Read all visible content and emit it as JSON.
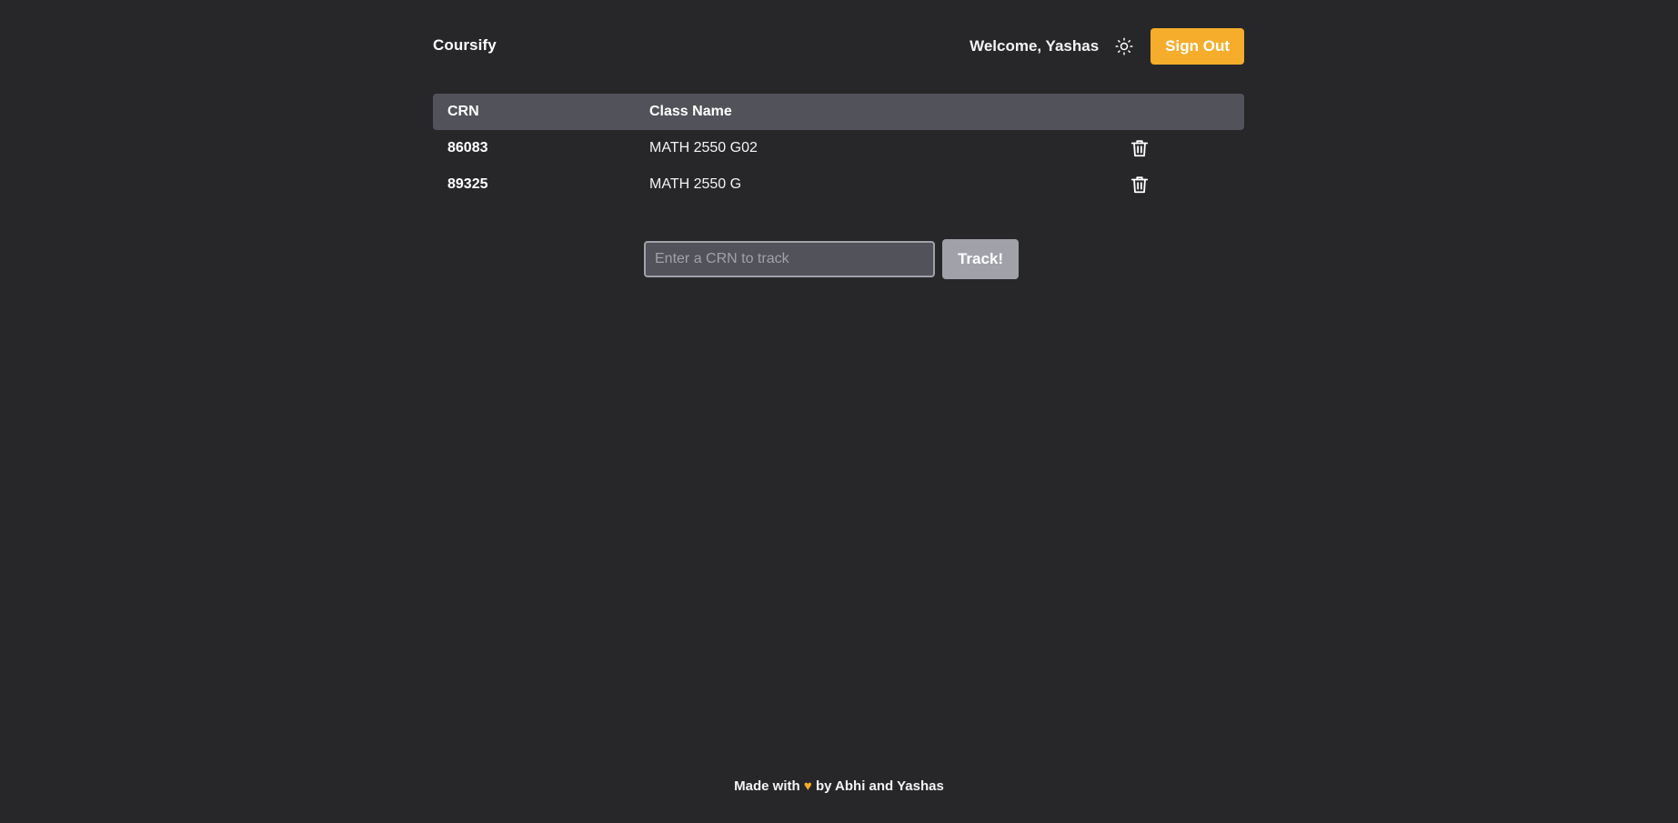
{
  "header": {
    "brand": "Coursify",
    "welcome": "Welcome, Yashas",
    "theme_icon": "sun-icon",
    "signout_label": "Sign Out"
  },
  "table": {
    "columns": [
      "CRN",
      "Class Name"
    ],
    "rows": [
      {
        "crn": "86083",
        "name": "MATH 2550 G02",
        "action_icon": "trash-icon"
      },
      {
        "crn": "89325",
        "name": "MATH 2550 G",
        "action_icon": "trash-icon"
      }
    ]
  },
  "tracker": {
    "placeholder": "Enter a CRN to track",
    "value": "",
    "button_label": "Track!"
  },
  "footer": {
    "prefix": "Made with",
    "heart": "♥",
    "suffix": "by Abhi and Yashas"
  },
  "colors": {
    "background": "#27272a",
    "accent": "#f5ad2b",
    "table_header": "#52525b",
    "muted": "#a1a1aa"
  }
}
